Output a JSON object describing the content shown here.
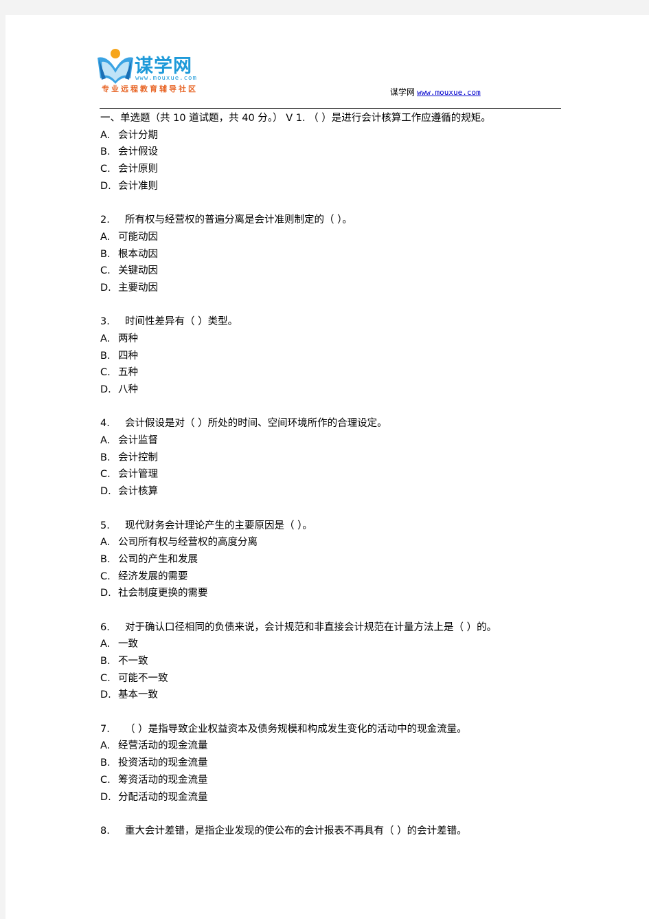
{
  "header": {
    "logo": {
      "name": "谋学网",
      "url": "www.mouxue.com",
      "slogan": "专业远程教育辅导社区"
    },
    "site_label": "谋学网",
    "site_link": "www.mouxue.com"
  },
  "section_title": "一、单选题（共 10 道试题，共 40 分。） V 1. （ ）是进行会计核算工作应遵循的规矩。",
  "questions": [
    {
      "number": "",
      "text": "",
      "options": [
        {
          "label": "A.",
          "text": "会计分期"
        },
        {
          "label": "B.",
          "text": "会计假设"
        },
        {
          "label": "C.",
          "text": "会计原则"
        },
        {
          "label": "D.",
          "text": "会计准则"
        }
      ]
    },
    {
      "number": "2.",
      "text": "所有权与经营权的普遍分离是会计准则制定的（ ）。",
      "options": [
        {
          "label": "A.",
          "text": "可能动因"
        },
        {
          "label": "B.",
          "text": "根本动因"
        },
        {
          "label": "C.",
          "text": "关键动因"
        },
        {
          "label": "D.",
          "text": "主要动因"
        }
      ]
    },
    {
      "number": "3.",
      "text": "时间性差异有（ ）类型。",
      "options": [
        {
          "label": "A.",
          "text": "两种"
        },
        {
          "label": "B.",
          "text": "四种"
        },
        {
          "label": "C.",
          "text": "五种"
        },
        {
          "label": "D.",
          "text": "八种"
        }
      ]
    },
    {
      "number": "4.",
      "text": "会计假设是对（ ）所处的时间、空间环境所作的合理设定。",
      "options": [
        {
          "label": "A.",
          "text": "会计监督"
        },
        {
          "label": "B.",
          "text": "会计控制"
        },
        {
          "label": "C.",
          "text": "会计管理"
        },
        {
          "label": "D.",
          "text": "会计核算"
        }
      ]
    },
    {
      "number": "5.",
      "text": "现代财务会计理论产生的主要原因是（ ）。",
      "options": [
        {
          "label": "A.",
          "text": "公司所有权与经营权的高度分离"
        },
        {
          "label": "B.",
          "text": "公司的产生和发展"
        },
        {
          "label": "C.",
          "text": "经济发展的需要"
        },
        {
          "label": "D.",
          "text": "社会制度更换的需要"
        }
      ]
    },
    {
      "number": "6.",
      "text": "对于确认口径相同的负债来说，会计规范和非直接会计规范在计量方法上是（ ）的。",
      "options": [
        {
          "label": "A.",
          "text": "一致"
        },
        {
          "label": "B.",
          "text": "不一致"
        },
        {
          "label": "C.",
          "text": "可能不一致"
        },
        {
          "label": "D.",
          "text": "基本一致"
        }
      ]
    },
    {
      "number": "7.",
      "text": "（ ）是指导致企业权益资本及债务规模和构成发生变化的活动中的现金流量。",
      "options": [
        {
          "label": "A.",
          "text": "经营活动的现金流量"
        },
        {
          "label": "B.",
          "text": "投资活动的现金流量"
        },
        {
          "label": "C.",
          "text": "筹资活动的现金流量"
        },
        {
          "label": "D.",
          "text": "分配活动的现金流量"
        }
      ]
    },
    {
      "number": "8.",
      "text": "重大会计差错，是指企业发现的使公布的会计报表不再具有（ ）的会计差错。",
      "options": []
    }
  ]
}
